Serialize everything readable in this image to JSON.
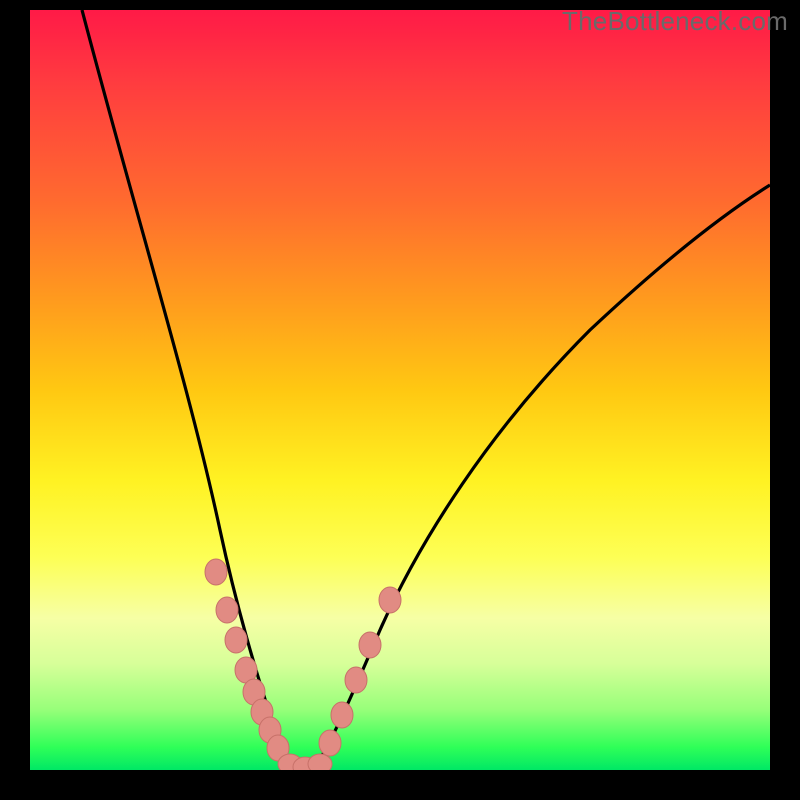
{
  "watermark": "TheBottleneck.com",
  "colors": {
    "frame": "#000000",
    "curve": "#000000",
    "marker_fill": "#e18b83",
    "marker_stroke": "#c77169"
  },
  "chart_data": {
    "type": "line",
    "title": "",
    "xlabel": "",
    "ylabel": "",
    "xlim": [
      0,
      100
    ],
    "ylim": [
      0,
      100
    ],
    "series": [
      {
        "name": "left-branch",
        "x": [
          7,
          12,
          17,
          21,
          24.5,
          26,
          27.5,
          29,
          30,
          31,
          32,
          33,
          34
        ],
        "y": [
          100,
          75,
          53,
          37,
          25.5,
          20.5,
          16.5,
          13,
          10.5,
          8,
          5.5,
          3,
          1
        ]
      },
      {
        "name": "right-branch",
        "x": [
          37,
          38.5,
          40,
          42,
          44,
          47,
          53,
          63,
          75,
          87,
          100
        ],
        "y": [
          1,
          4,
          8,
          13,
          18,
          25,
          38,
          53,
          64,
          72,
          78
        ]
      }
    ],
    "markers": [
      {
        "series": "left-branch",
        "points": [
          {
            "x": 24.5,
            "y": 25.5
          },
          {
            "x": 26,
            "y": 20.5
          },
          {
            "x": 27.5,
            "y": 16.5
          },
          {
            "x": 29,
            "y": 13
          },
          {
            "x": 30,
            "y": 10.5
          },
          {
            "x": 31,
            "y": 8
          },
          {
            "x": 32,
            "y": 5.5
          },
          {
            "x": 33,
            "y": 3
          }
        ]
      },
      {
        "series": "right-branch",
        "points": [
          {
            "x": 38.5,
            "y": 4
          },
          {
            "x": 40,
            "y": 8
          },
          {
            "x": 42,
            "y": 13
          },
          {
            "x": 44,
            "y": 18
          },
          {
            "x": 47,
            "y": 25
          }
        ]
      },
      {
        "series": "valley",
        "points": [
          {
            "x": 34,
            "y": 1
          },
          {
            "x": 35.5,
            "y": 0.5
          },
          {
            "x": 37,
            "y": 1
          }
        ]
      }
    ]
  }
}
